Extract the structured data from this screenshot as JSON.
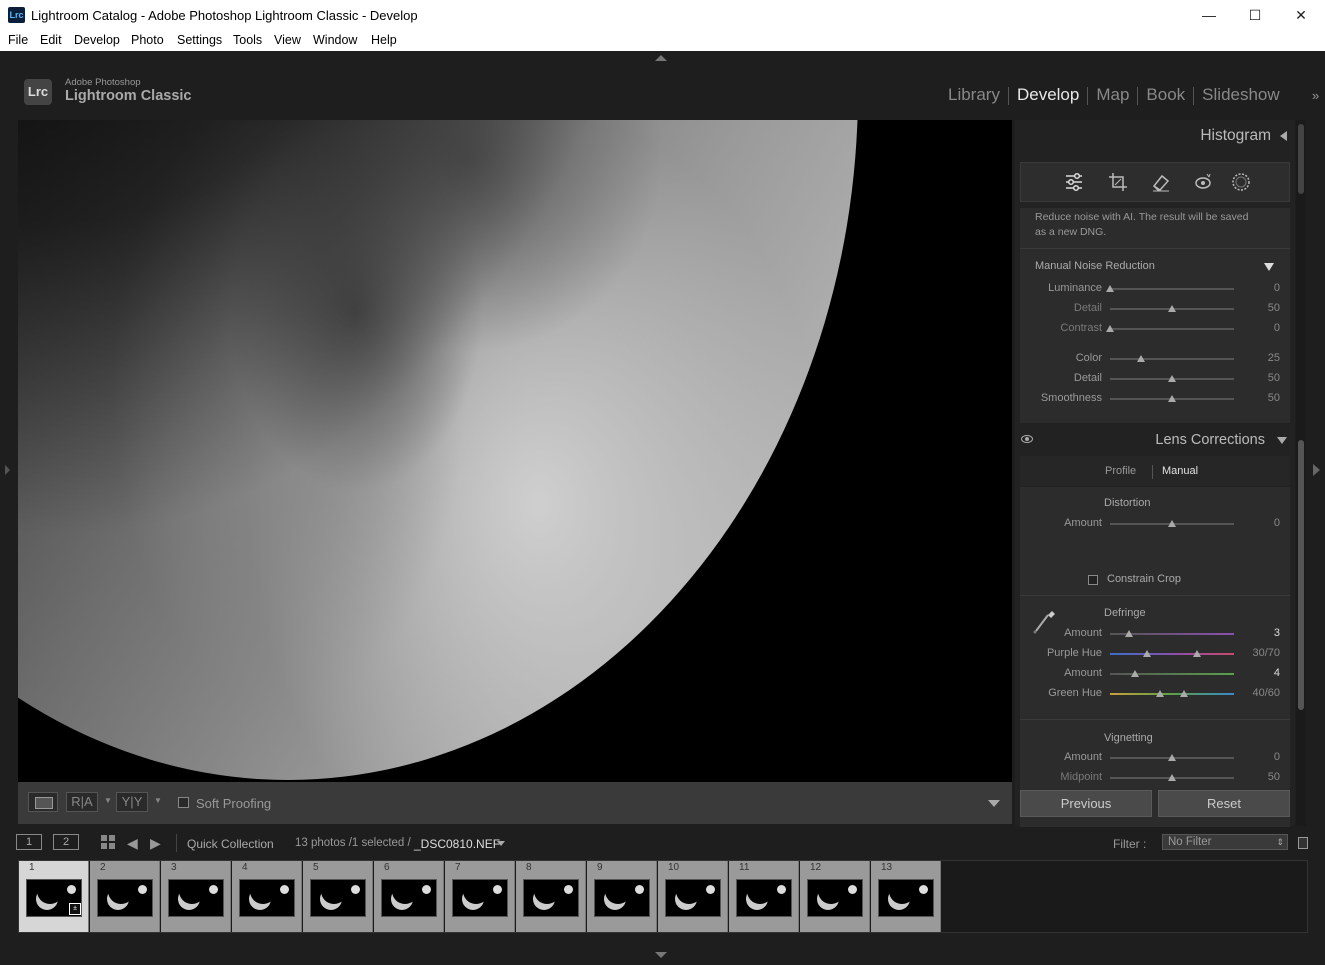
{
  "window": {
    "title": "Lightroom Catalog - Adobe Photoshop Lightroom Classic - Develop",
    "app_icon": "Lrc",
    "minimize": "—",
    "maximize": "☐",
    "close": "✕"
  },
  "menu": [
    "File",
    "Edit",
    "Develop",
    "Photo",
    "Settings",
    "Tools",
    "View",
    "Window",
    "Help"
  ],
  "identity": {
    "logo": "Lrc",
    "brand_small": "Adobe Photoshop",
    "brand_large": "Lightroom Classic"
  },
  "modules": {
    "items": [
      "Library",
      "Develop",
      "Map",
      "Book",
      "Slideshow"
    ],
    "active": "Develop",
    "more": "»"
  },
  "toolbar": {
    "compare_ra": "R|A",
    "compare_yy": "Y|Y",
    "soft_proofing": "Soft Proofing"
  },
  "histogram": {
    "title": "Histogram"
  },
  "tools": [
    "edit-sliders-icon",
    "crop-icon",
    "eraser-icon",
    "redeye-icon",
    "mask-icon"
  ],
  "noise": {
    "ai_text_1": "Reduce noise with AI. The result will be saved",
    "ai_text_2": "as a new DNG.",
    "manual_title": "Manual Noise Reduction",
    "sliders": [
      {
        "label": "Luminance",
        "value": "0",
        "pos": 0.0,
        "dim": false
      },
      {
        "label": "Detail",
        "value": "50",
        "pos": 0.5,
        "dim": true
      },
      {
        "label": "Contrast",
        "value": "0",
        "pos": 0.0,
        "dim": true
      },
      {
        "label": "Color",
        "value": "25",
        "pos": 0.25,
        "dim": false
      },
      {
        "label": "Detail",
        "value": "50",
        "pos": 0.5,
        "dim": false
      },
      {
        "label": "Smoothness",
        "value": "50",
        "pos": 0.5,
        "dim": false
      }
    ]
  },
  "lens": {
    "title": "Lens Corrections",
    "tab_profile": "Profile",
    "tab_manual": "Manual",
    "distortion_title": "Distortion",
    "distortion_amount_label": "Amount",
    "distortion_amount_value": "0",
    "distortion_pos": 0.5,
    "constrain_crop": "Constrain Crop",
    "defringe_title": "Defringe",
    "defringe": [
      {
        "label": "Amount",
        "value": "3",
        "bright": true
      },
      {
        "label": "Purple Hue",
        "value": "30/70",
        "bright": false
      },
      {
        "label": "Amount",
        "value": "4",
        "bright": true
      },
      {
        "label": "Green Hue",
        "value": "40/60",
        "bright": false
      }
    ],
    "purple_amount_pos": 0.15,
    "purple_hue_range": [
      0.3,
      0.7
    ],
    "green_amount_pos": 0.2,
    "green_hue_range": [
      0.4,
      0.6
    ],
    "vignetting_title": "Vignetting",
    "vignetting": [
      {
        "label": "Amount",
        "value": "0",
        "pos": 0.5
      },
      {
        "label": "Midpoint",
        "value": "50",
        "pos": 0.5
      }
    ]
  },
  "buttons": {
    "previous": "Previous",
    "reset": "Reset"
  },
  "filmbar": {
    "screen1": "1",
    "screen2": "2",
    "collection": "Quick Collection",
    "count": "13 photos /1 selected /",
    "filename": "_DSC0810.NEF",
    "filter_label": "Filter :",
    "filter_value": "No Filter"
  },
  "filmstrip": {
    "thumbs": [
      "1",
      "2",
      "3",
      "4",
      "5",
      "6",
      "7",
      "8",
      "9",
      "10",
      "11",
      "12",
      "13"
    ],
    "selected_index": 0
  },
  "colors": {
    "purple_track": "#8a4fb0",
    "green_track": "#5aa04a"
  }
}
